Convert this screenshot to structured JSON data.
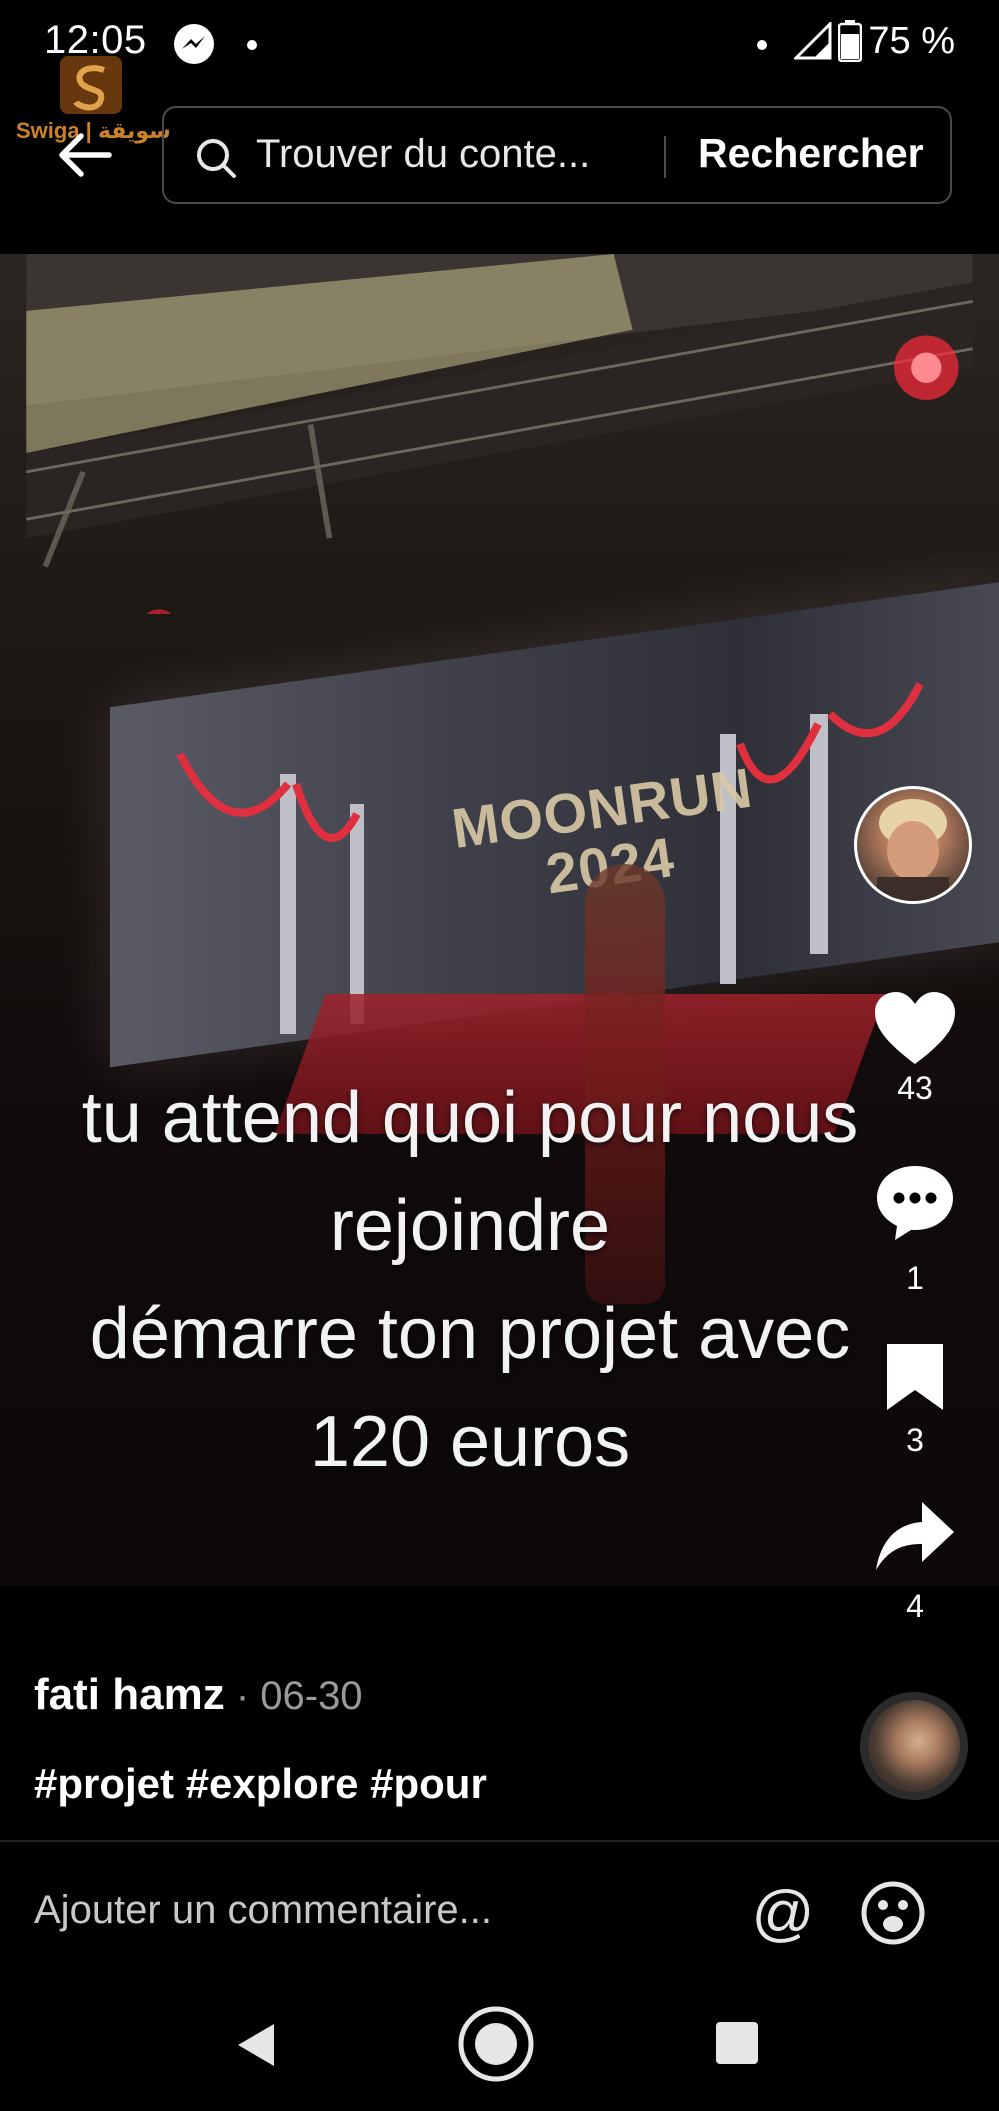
{
  "status_bar": {
    "time": "12:05",
    "battery": "75 %"
  },
  "watermark": {
    "text": "Swiga | سويقة"
  },
  "header": {
    "search_placeholder": "Trouver du conte...",
    "search_button": "Rechercher"
  },
  "video": {
    "screen_logo_line1": "MOONRUN",
    "screen_logo_line2": "2024",
    "overlay_lines": [
      "tu attend quoi pour nous",
      "rejoindre",
      "démarre ton projet avec",
      "120 euros"
    ]
  },
  "actions": {
    "likes": "43",
    "comments": "1",
    "saves": "3",
    "shares": "4"
  },
  "post": {
    "author": "fati hamz",
    "date": " · 06-30",
    "hashtags": "#projet #explore #pour"
  },
  "comment_bar": {
    "placeholder": "Ajouter un commentaire...",
    "mention": "@"
  },
  "icons": {
    "messenger": "messenger-icon",
    "signal": "signal-icon",
    "battery": "battery-icon",
    "back": "arrow-left-icon",
    "search": "search-icon",
    "like": "heart-icon",
    "comment": "comment-bubble-icon",
    "save": "bookmark-icon",
    "share": "share-arrow-icon",
    "emoji": "emoji-icon"
  }
}
